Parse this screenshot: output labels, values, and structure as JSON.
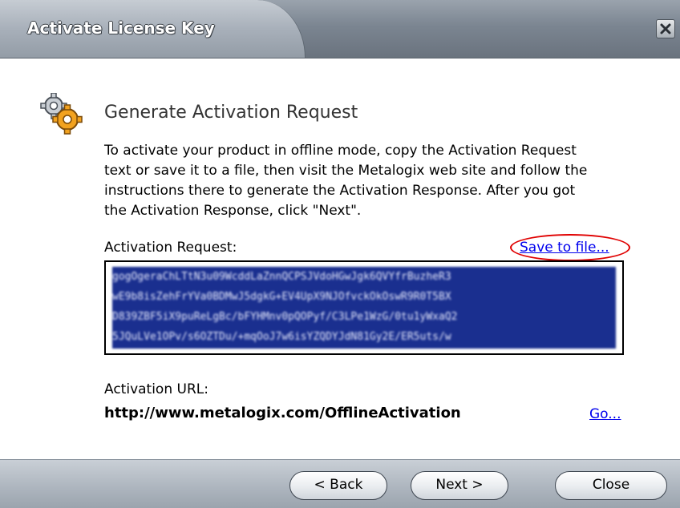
{
  "window": {
    "title": "Activate License Key"
  },
  "main": {
    "heading": "Generate Activation Request",
    "description": "To activate your product in offline mode, copy the Activation Request\ntext or save it to a file, then visit the Metalogix web site and follow the\ninstructions there to generate the Activation Response. After you got\nthe Activation Response, click \"Next\".",
    "request_label": "Activation Request:",
    "save_link": "Save to file...",
    "request_text": "gogOgeraChLTtN3u09WcddLaZnnQCPSJVdoHGwJgk6QVYfrBuzheR3\nwE9b8isZehFrYVa0BDMwJ5dgkG+EV4UpX9NJOfvckOkOswR9R0T5BX\nD839ZBF5iX9puReLgBc/bFYHMnv0pQOPyf/C3LPe1WzG/0tu1yWxaQ2\n5JQuLVe1OPv/s6OZTDu/+mqOoJ7w6isYZQDYJdN81Gy2E/ER5uts/w",
    "url_label": "Activation URL:",
    "url_value": "http://www.metalogix.com/OfflineActivation",
    "go_link": "Go..."
  },
  "footer": {
    "back_label": "< Back",
    "next_label": "Next >",
    "close_label": "Close"
  }
}
